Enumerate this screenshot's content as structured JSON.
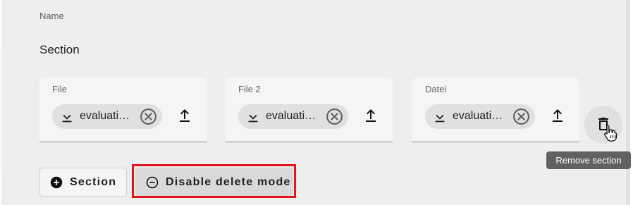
{
  "form": {
    "name_label": "Name",
    "section_title": "Section",
    "fields": [
      {
        "label": "File",
        "file_name": "evaluation.pdf"
      },
      {
        "label": "File 2",
        "file_name": "evaluation.pdf"
      },
      {
        "label": "Datei",
        "file_name": "evaluation.pdf"
      }
    ]
  },
  "actions": {
    "add_section_label": "Section",
    "disable_delete_label": "Disable delete mode",
    "remove_section_tooltip": "Remove section"
  },
  "icons": {
    "download": "download-icon",
    "remove": "cancel-circle-icon",
    "upload": "upload-icon",
    "trash": "delete-icon",
    "add": "add-circle-icon",
    "minus": "remove-circle-icon"
  },
  "colors": {
    "highlight": "#e0161c",
    "tooltip_bg": "#616161"
  }
}
